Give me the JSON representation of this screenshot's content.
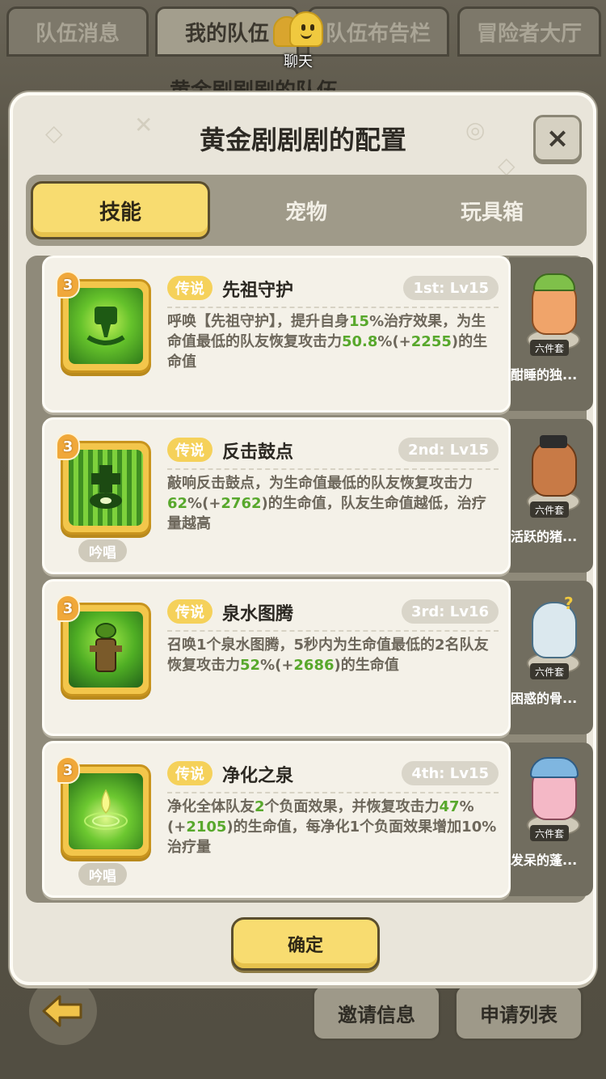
{
  "top_tabs": [
    {
      "label": "队伍消息"
    },
    {
      "label": "我的队伍"
    },
    {
      "label": "队伍布告栏"
    },
    {
      "label": "冒险者大厅"
    }
  ],
  "chat": {
    "label": "聊天"
  },
  "background_title": "黄金剧剧剧的队伍",
  "bottom_buttons": {
    "invite": "邀请信息",
    "apply": "申请列表"
  },
  "modal": {
    "title": "黄金剧剧剧的配置",
    "close": "×",
    "tabs": [
      {
        "label": "技能",
        "active": true
      },
      {
        "label": "宠物",
        "active": false
      },
      {
        "label": "玩具箱",
        "active": false
      }
    ],
    "confirm": "确定"
  },
  "skills": [
    {
      "rank": "3",
      "rarity": "传说",
      "name": "先祖守护",
      "level": "1st: Lv15",
      "chant": "",
      "desc_parts": [
        "呼唤【先祖守护】，提升自身",
        "15",
        "%治疗效果，为生命值最低的队友恢复攻击力",
        "50.8",
        "%(+",
        "2255",
        ")的生命值"
      ]
    },
    {
      "rank": "3",
      "rarity": "传说",
      "name": "反击鼓点",
      "level": "2nd: Lv15",
      "chant": "吟唱",
      "desc_parts": [
        "敲响反击鼓点，为生命值最低的队友恢复攻击力",
        "62",
        "%(+",
        "2762",
        ")的生命值，队友生命值越低，治疗量越高"
      ]
    },
    {
      "rank": "3",
      "rarity": "传说",
      "name": "泉水图腾",
      "level": "3rd: Lv16",
      "chant": "",
      "desc_parts": [
        "召唤1个泉水图腾，5秒内为生命值最低的2名队友恢复攻击力",
        "52",
        "%(+",
        "2686",
        ")的生命值"
      ]
    },
    {
      "rank": "3",
      "rarity": "传说",
      "name": "净化之泉",
      "level": "4th: Lv15",
      "chant": "吟唱",
      "desc_parts": [
        "净化全体队友",
        "2",
        "个负面效果，并恢复攻击力",
        "47",
        "%(+",
        "2105",
        ")的生命值，每净化1个负面效果增加10%治疗量"
      ]
    }
  ],
  "companions": [
    {
      "set": "六件套",
      "name": "酣睡的独..."
    },
    {
      "set": "六件套",
      "name": "活跃的猪..."
    },
    {
      "set": "六件套",
      "name": "困惑的骨..."
    },
    {
      "set": "六件套",
      "name": "发呆的蓬..."
    }
  ],
  "colors": {
    "accent_yellow": "#f8dc70",
    "highlight_green": "#58a82c",
    "legend_tag": "#f5d15a"
  }
}
